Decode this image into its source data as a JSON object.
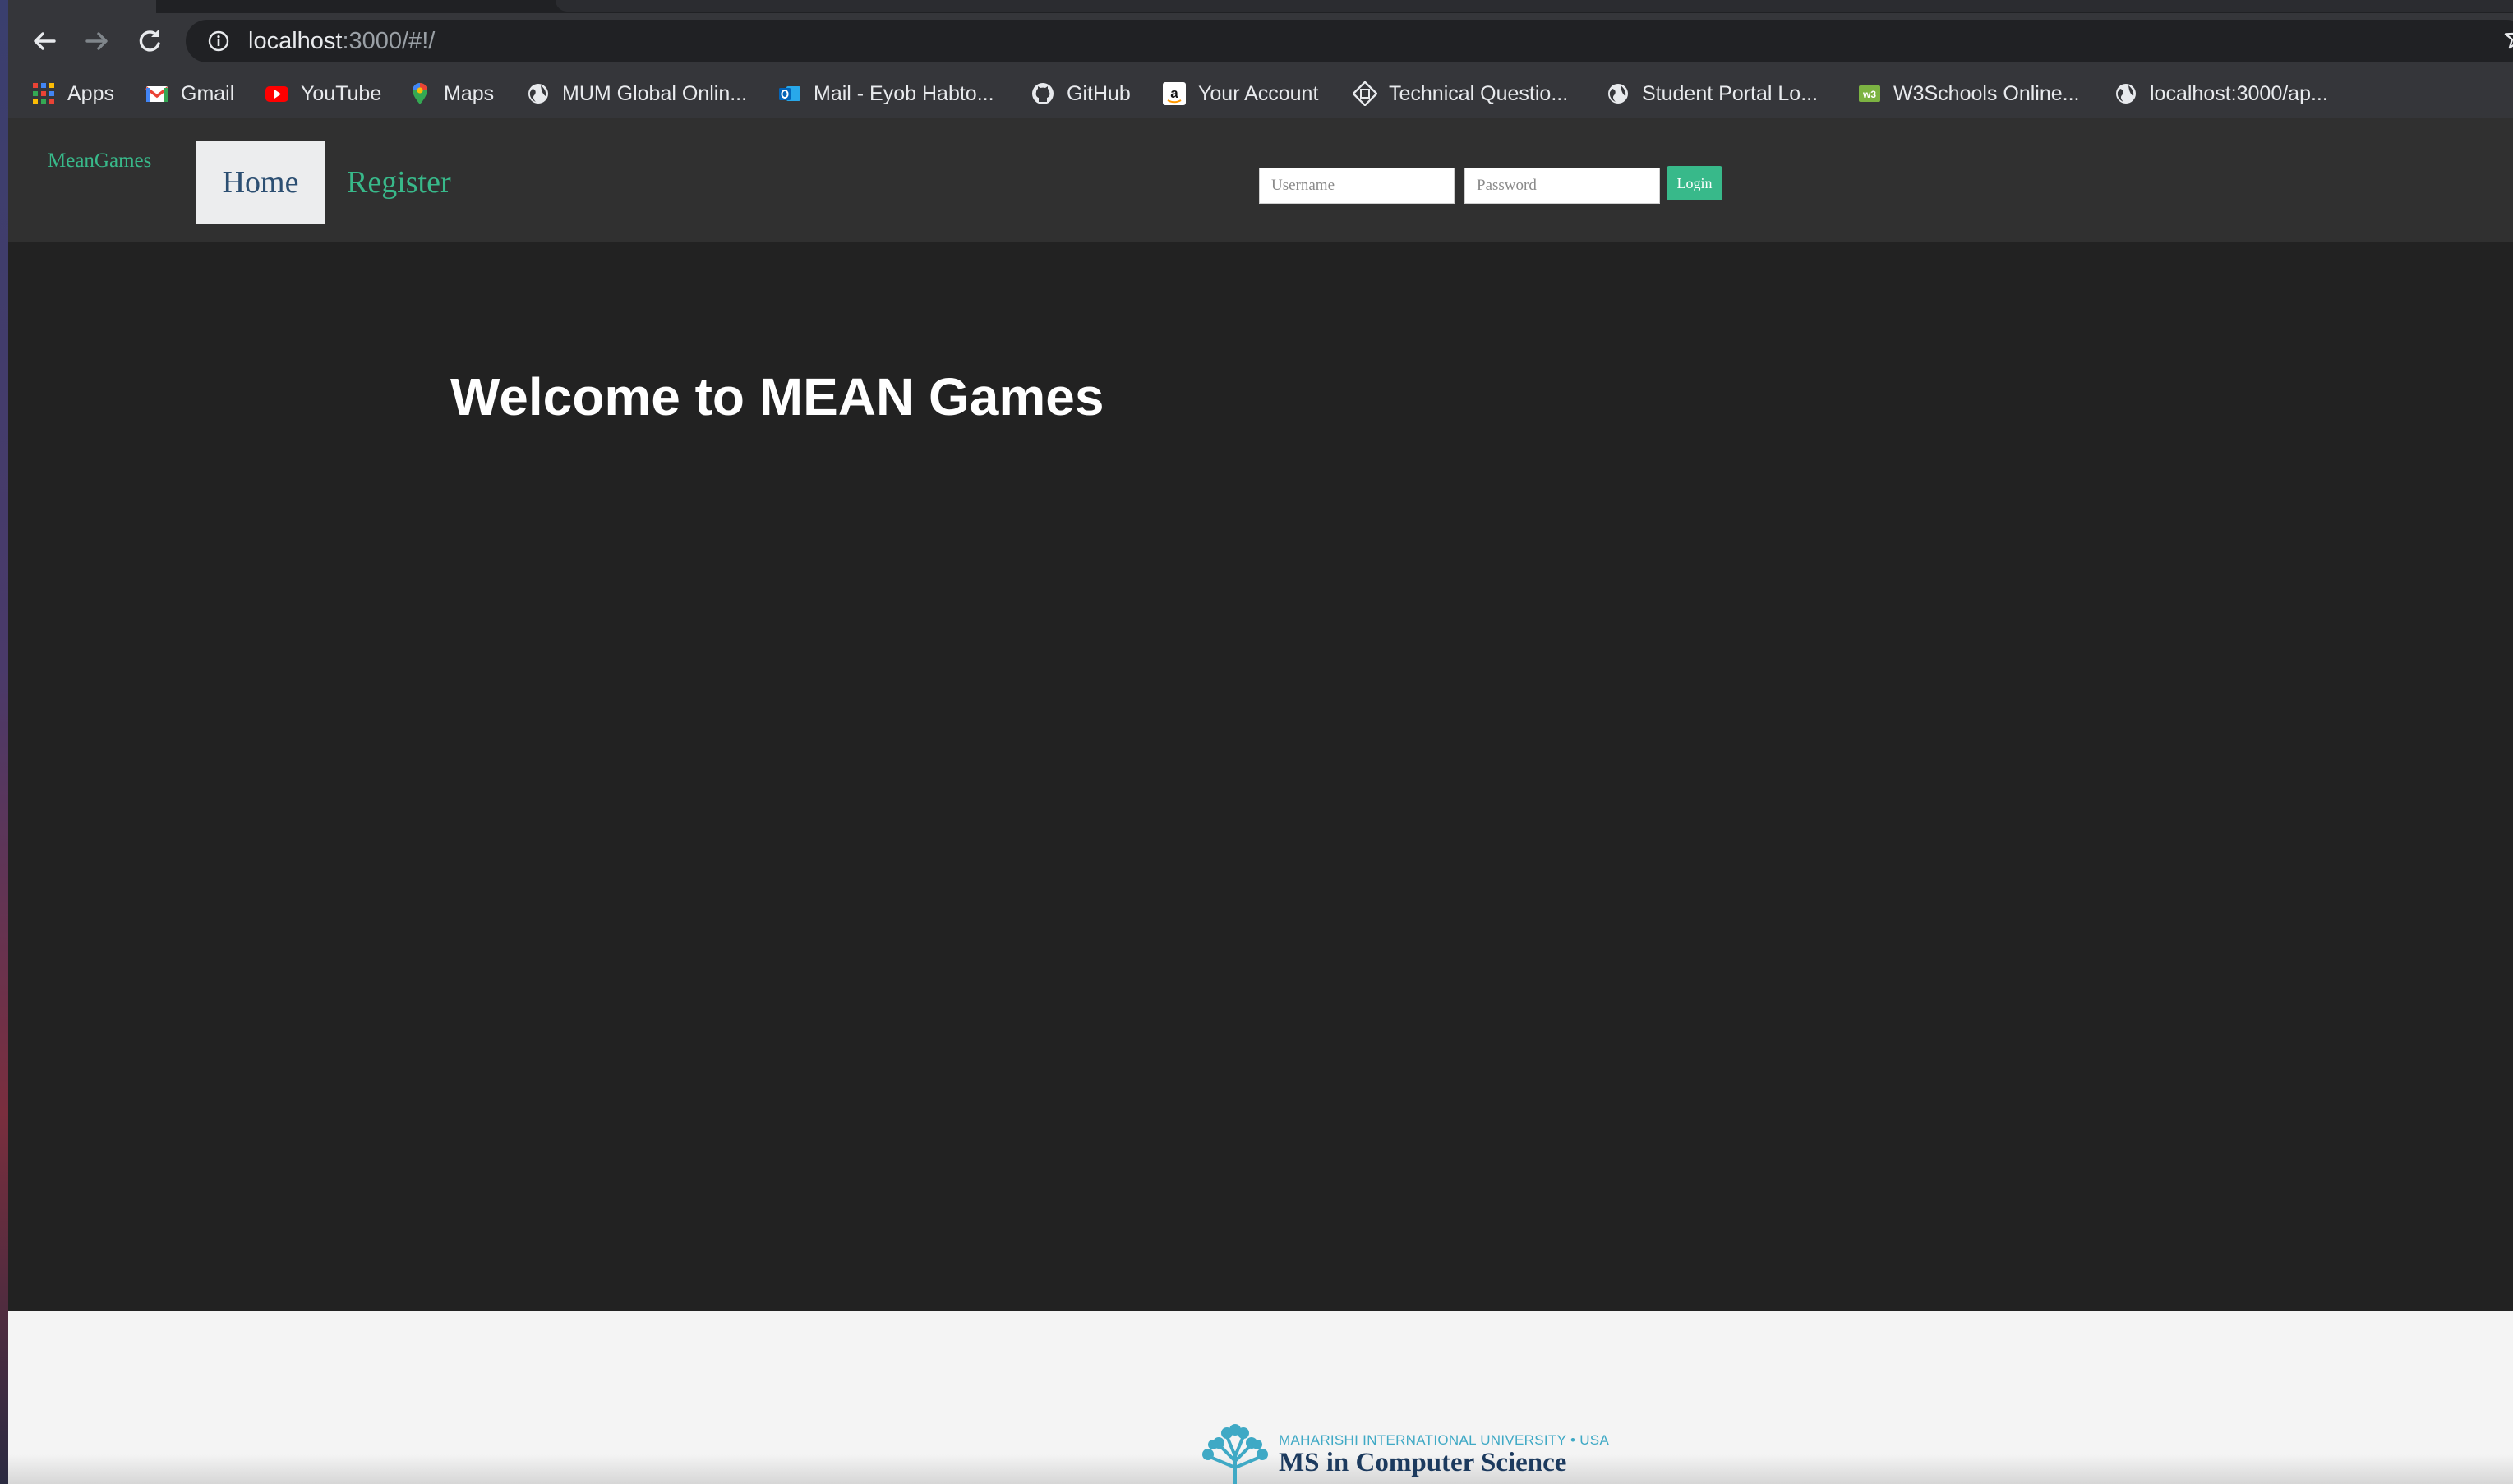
{
  "browser": {
    "url_host": "localhost",
    "url_path": ":3000/#!/",
    "icons": {
      "back": "arrow-left-icon",
      "forward": "arrow-right-icon",
      "reload": "reload-icon",
      "info": "info-icon",
      "bookmark": "star-icon"
    }
  },
  "bookmarks": [
    {
      "label": "Apps",
      "icon": "apps-grid-icon"
    },
    {
      "label": "Gmail",
      "icon": "gmail-icon"
    },
    {
      "label": "YouTube",
      "icon": "youtube-icon"
    },
    {
      "label": "Maps",
      "icon": "maps-pin-icon"
    },
    {
      "label": "MUM Global Onlin...",
      "icon": "globe-icon"
    },
    {
      "label": "Mail - Eyob Habto...",
      "icon": "outlook-icon"
    },
    {
      "label": "GitHub",
      "icon": "github-icon"
    },
    {
      "label": "Your Account",
      "icon": "amazon-icon"
    },
    {
      "label": "Technical Questio...",
      "icon": "site-icon"
    },
    {
      "label": "Student Portal Lo...",
      "icon": "globe-icon"
    },
    {
      "label": "W3Schools Online...",
      "icon": "w3schools-icon"
    },
    {
      "label": "localhost:3000/ap...",
      "icon": "globe-icon"
    }
  ],
  "app": {
    "brand": "MeanGames",
    "nav": {
      "home": "Home",
      "register": "Register"
    },
    "login": {
      "username_placeholder": "Username",
      "password_placeholder": "Password",
      "button": "Login"
    },
    "welcome": "Welcome to MEAN Games"
  },
  "footer": {
    "logo_subtitle": "MAHARISHI INTERNATIONAL UNIVERSITY • USA",
    "logo_title": "MS in Computer Science"
  },
  "colors": {
    "accent": "#38b98a",
    "navbar": "#303030",
    "page_bg": "#222222",
    "footer_bg": "#f4f4f4",
    "nav_active_text": "#2c4f72"
  }
}
